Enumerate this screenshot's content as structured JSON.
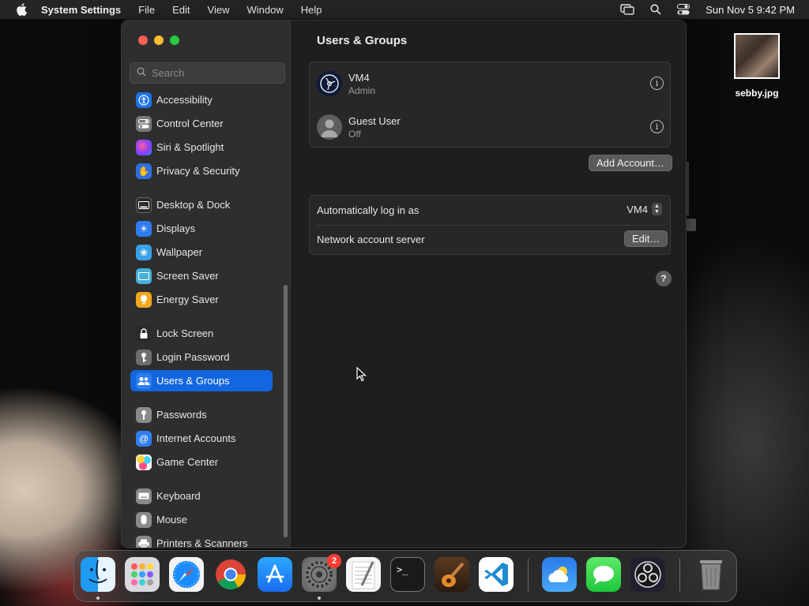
{
  "menubar": {
    "app_name": "System Settings",
    "menus": [
      "File",
      "Edit",
      "View",
      "Window",
      "Help"
    ],
    "clock": "Sun Nov 5  9:42 PM"
  },
  "sidebar": {
    "search_placeholder": "Search",
    "items": [
      {
        "label": "Accessibility",
        "icon": "accessibility-icon",
        "color": "#1a73e8"
      },
      {
        "label": "Control Center",
        "icon": "control-center-icon",
        "color": "#7a7a7a"
      },
      {
        "label": "Siri & Spotlight",
        "icon": "siri-icon",
        "color": "#8a3cc8"
      },
      {
        "label": "Privacy & Security",
        "icon": "hand-icon",
        "color": "#2f6fe0"
      },
      {
        "label": "Desktop & Dock",
        "icon": "dock-icon",
        "color": "#2a2a2a"
      },
      {
        "label": "Displays",
        "icon": "sun-icon",
        "color": "#2d7cf0"
      },
      {
        "label": "Wallpaper",
        "icon": "flower-icon",
        "color": "#3aa0e8"
      },
      {
        "label": "Screen Saver",
        "icon": "screen-saver-icon",
        "color": "#48b0d8"
      },
      {
        "label": "Energy Saver",
        "icon": "bulb-icon",
        "color": "#f2a81d"
      },
      {
        "label": "Lock Screen",
        "icon": "lock-icon",
        "color": "#2a2a2a"
      },
      {
        "label": "Login Password",
        "icon": "key-icon",
        "color": "#6e6e6e"
      },
      {
        "label": "Users & Groups",
        "icon": "users-icon",
        "color": "#2f7ff0"
      },
      {
        "label": "Passwords",
        "icon": "key-icon",
        "color": "#8a8a8a"
      },
      {
        "label": "Internet Accounts",
        "icon": "at-icon",
        "color": "#2f7ff0"
      },
      {
        "label": "Game Center",
        "icon": "game-center-icon",
        "color": "#e84a8a"
      },
      {
        "label": "Keyboard",
        "icon": "keyboard-icon",
        "color": "#8a8a8a"
      },
      {
        "label": "Mouse",
        "icon": "mouse-icon",
        "color": "#8a8a8a"
      },
      {
        "label": "Printers & Scanners",
        "icon": "printer-icon",
        "color": "#8a8a8a"
      }
    ],
    "selected": "Users & Groups"
  },
  "content": {
    "title": "Users & Groups",
    "users": [
      {
        "name": "VM4",
        "role": "Admin"
      },
      {
        "name": "Guest User",
        "role": "Off"
      }
    ],
    "add_account_label": "Add Account…",
    "auto_login_label": "Automatically log in as",
    "auto_login_value": "VM4",
    "network_server_label": "Network account server",
    "edit_label": "Edit…",
    "help_label": "?"
  },
  "desktop": {
    "file_name": "sebby.jpg"
  },
  "dock": {
    "apps": [
      "Finder",
      "Launchpad",
      "Safari",
      "Chrome",
      "App Store",
      "System Settings",
      "TextEdit",
      "Terminal",
      "GarageBand",
      "VS Code",
      "Weather",
      "Messages",
      "OBS",
      "Trash"
    ],
    "settings_badge": "2"
  }
}
